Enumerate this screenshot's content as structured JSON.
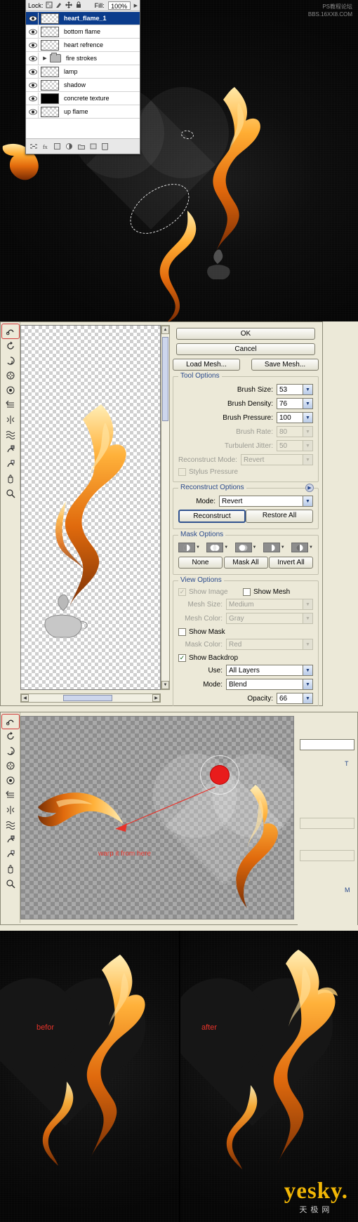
{
  "watermark_top": {
    "line1": "PS教程论坛",
    "line2": "BBS.16XX8.COM"
  },
  "layers_panel": {
    "lock_label": "Lock:",
    "lock_icons": [
      "lock-transparent-pixels-icon",
      "lock-image-pixels-icon",
      "lock-position-icon",
      "lock-all-icon"
    ],
    "fill_label": "Fill:",
    "fill_value": "100%",
    "menu_arrow": "▶",
    "rows": [
      {
        "name": "heart_flame_1",
        "type": "layer",
        "selected": true,
        "thumb": "checker"
      },
      {
        "name": "bottom flame",
        "type": "layer",
        "selected": false,
        "thumb": "checker"
      },
      {
        "name": "heart refrence",
        "type": "layer",
        "selected": false,
        "thumb": "checker"
      },
      {
        "name": "fire strokes",
        "type": "group",
        "selected": false,
        "thumb": "folder"
      },
      {
        "name": "lamp",
        "type": "layer",
        "selected": false,
        "thumb": "checker"
      },
      {
        "name": "shadow",
        "type": "layer",
        "selected": false,
        "thumb": "checker"
      },
      {
        "name": "concrete texture",
        "type": "layer",
        "selected": false,
        "thumb": "black"
      },
      {
        "name": "up flame",
        "type": "layer",
        "selected": false,
        "thumb": "checker"
      }
    ],
    "toolbar_icons": [
      "link-layers-icon",
      "layer-style-icon",
      "add-layer-mask-icon",
      "new-fill-adjustment-icon",
      "new-group-icon",
      "new-layer-icon",
      "delete-layer-icon"
    ],
    "selected_color": "#0b3c8c"
  },
  "liquify": {
    "ok_label": "OK",
    "cancel_label": "Cancel",
    "load_mesh_label": "Load Mesh...",
    "save_mesh_label": "Save Mesh...",
    "tools": [
      "forward-warp-tool-icon",
      "reconstruct-tool-icon",
      "twirl-clockwise-tool-icon",
      "pucker-tool-icon",
      "bloat-tool-icon",
      "push-left-tool-icon",
      "mirror-tool-icon",
      "turbulence-tool-icon",
      "freeze-mask-tool-icon",
      "thaw-mask-tool-icon",
      "hand-tool-icon",
      "zoom-tool-icon"
    ],
    "tool_options": {
      "legend": "Tool Options",
      "fields": [
        {
          "label": "Brush Size:",
          "value": "53",
          "disabled": false
        },
        {
          "label": "Brush Density:",
          "value": "76",
          "disabled": false
        },
        {
          "label": "Brush Pressure:",
          "value": "100",
          "disabled": false
        },
        {
          "label": "Brush Rate:",
          "value": "80",
          "disabled": true
        },
        {
          "label": "Turbulent Jitter:",
          "value": "50",
          "disabled": true
        },
        {
          "label": "Reconstruct Mode:",
          "value": "Revert",
          "disabled": true,
          "wide": true
        }
      ],
      "stylus_pressure_label": "Stylus Pressure",
      "stylus_pressure_checked": false,
      "stylus_pressure_disabled": true
    },
    "reconstruct_options": {
      "legend": "Reconstruct Options",
      "mode_label": "Mode:",
      "mode_value": "Revert",
      "reconstruct_label": "Reconstruct",
      "restore_all_label": "Restore All"
    },
    "mask_options": {
      "legend": "Mask Options",
      "icons": [
        "replace-selection-icon",
        "add-to-selection-icon",
        "subtract-from-selection-icon",
        "intersect-with-selection-icon",
        "invert-selection-icon"
      ],
      "none_label": "None",
      "mask_all_label": "Mask All",
      "invert_all_label": "Invert All"
    },
    "view_options": {
      "legend": "View Options",
      "show_image_label": "Show Image",
      "show_image_checked": true,
      "show_image_disabled": true,
      "show_mesh_label": "Show Mesh",
      "show_mesh_checked": false,
      "mesh_size_label": "Mesh Size:",
      "mesh_size_value": "Medium",
      "mesh_color_label": "Mesh Color:",
      "mesh_color_value": "Gray",
      "show_mask_label": "Show Mask",
      "show_mask_checked": false,
      "mask_color_label": "Mask Color:",
      "mask_color_value": "Red",
      "show_backdrop_label": "Show Backdrop",
      "show_backdrop_checked": true,
      "use_label": "Use:",
      "use_value": "All Layers",
      "mode_label": "Mode:",
      "mode_value": "Blend",
      "opacity_label": "Opacity:",
      "opacity_value": "66"
    }
  },
  "annotation": {
    "warp_text": "warp it from here",
    "color": "#e8332a"
  },
  "before_after": {
    "before_label": "befor",
    "after_label": "after",
    "color": "#e8332a"
  },
  "logo": {
    "word": "yesky",
    "dot": ".",
    "sub": "天极网",
    "color": "#f2b705"
  }
}
